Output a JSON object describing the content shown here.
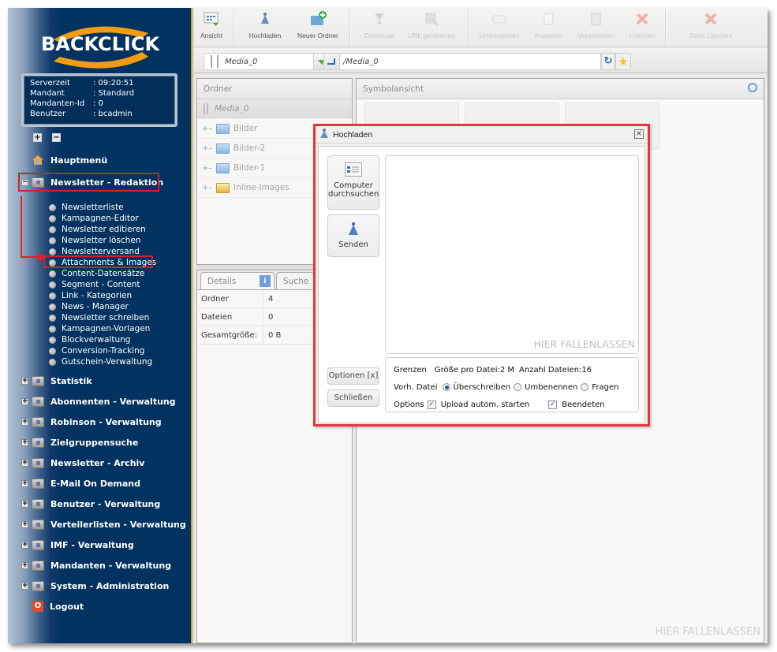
{
  "brand": {
    "logo_text": "BACKCLICK",
    "accent": "#f39c12",
    "sidebar_bg": "#02325f"
  },
  "info": [
    {
      "key": "Serverzeit",
      "value": ": 09:20:51"
    },
    {
      "key": "Mandant",
      "value": ": Standard"
    },
    {
      "key": "Mandanten-Id",
      "value": ": 0"
    },
    {
      "key": "Benutzer",
      "value": ": bcadmin"
    }
  ],
  "expand_all": "+",
  "collapse_all": "−",
  "nav": {
    "home": "Hauptmenü",
    "active_section": "Newsletter - Redaktion",
    "sub_items": [
      "Newsletterliste",
      "Kampagnen-Editor",
      "Newsletter editieren",
      "Newsletter löschen",
      "Newsletterversand",
      "Attachments & Images",
      "Content-Datensätze",
      "Segment - Content",
      "Link - Kategorien",
      "News - Manager",
      "Newsletter schreiben",
      "Kampagnen-Vorlagen",
      "Blockverwaltung",
      "Conversion-Tracking",
      "Gutschein-Verwaltung"
    ],
    "sections": [
      "Statistik",
      "Abonnenten - Verwaltung",
      "Robinson - Verwaltung",
      "Zielgruppensuche",
      "Newsletter - Archiv",
      "E-Mail On Demand",
      "Benutzer - Verwaltung",
      "Verteilerlisten - Verwaltung",
      "IMF - Verwaltung",
      "Mandanten - Verwaltung",
      "System - Administration"
    ],
    "logout": "Logout"
  },
  "toolbar": {
    "view": "Ansicht",
    "upload": "Hochladen",
    "new_folder": "Neuer Ordner",
    "download": "Download",
    "gen_url": "URL generieren",
    "rename": "Umbenennen",
    "copy": "Kopieren",
    "move": "Verschieben",
    "delete": "Löschen",
    "delete_file": "Datei Löschen"
  },
  "address": {
    "root_select": "Media_0",
    "path": "/Media_0"
  },
  "folders": {
    "title": "Ordner",
    "root": "Media_0",
    "items": [
      "Bilder",
      "Bilder-2",
      "Bilder-1",
      "Inline-Images"
    ]
  },
  "details": {
    "tab_details": "Details",
    "tab_search": "Suche",
    "rows": [
      {
        "key": "Ordner",
        "value": "4"
      },
      {
        "key": "Dateien",
        "value": "0"
      },
      {
        "key": "Gesamtgröße:",
        "value": "0 B"
      }
    ]
  },
  "symbol_view": {
    "title": "Symbolansicht",
    "drop_hint": "HIER FALLENLASSEN"
  },
  "dialog": {
    "title": "Hochladen",
    "browse": [
      "Computer",
      "durchsuchen"
    ],
    "send": "Senden",
    "drop_hint": "HIER FALLENLASSEN",
    "options_btn": "Optionen [x]",
    "close_btn": "Schließen",
    "limits_label": "Grenzen",
    "limits_size": "Größe pro Datei:2 M",
    "limits_count": "Anzahl Dateien:16",
    "existing_label": "Vorh. Datei",
    "existing_options": [
      {
        "label": "Überschreiben",
        "selected": true
      },
      {
        "label": "Umbenennen",
        "selected": false
      },
      {
        "label": "Fragen",
        "selected": false
      }
    ],
    "options_label": "Options",
    "auto_start": {
      "label": "Upload autom. starten",
      "checked": true
    },
    "finish": {
      "label": "Beendeten",
      "checked": true
    }
  }
}
